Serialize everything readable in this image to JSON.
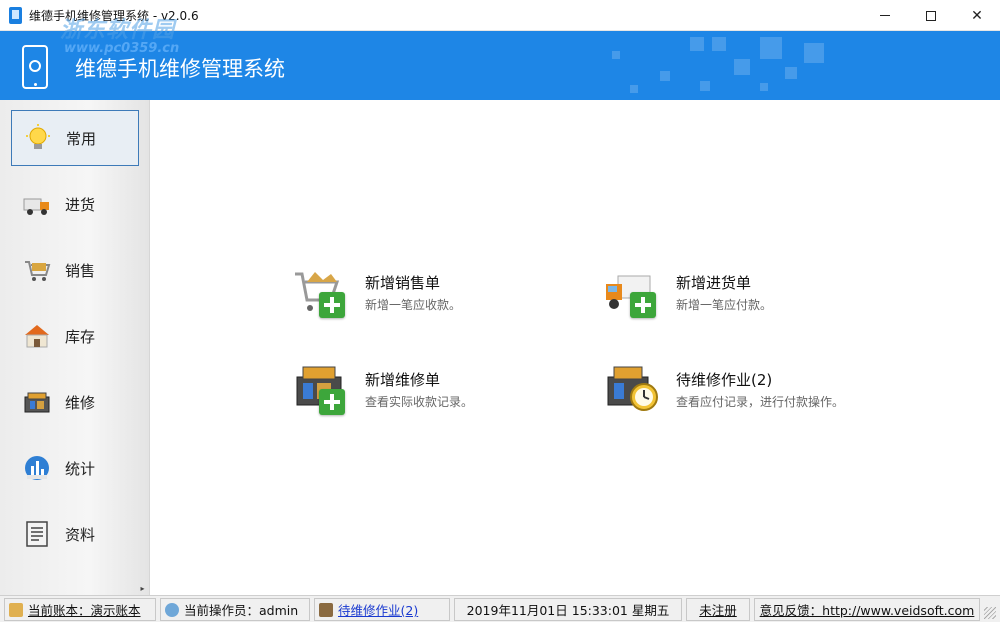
{
  "window": {
    "title": "维德手机维修管理系统 - v2.0.6"
  },
  "watermark": {
    "text": "浙东软件园",
    "url": "www.pc0359.cn"
  },
  "header": {
    "title": "维德手机维修管理系统"
  },
  "sidebar": {
    "items": [
      {
        "label": "常用",
        "icon": "bulb-icon",
        "active": true
      },
      {
        "label": "进货",
        "icon": "truck-icon"
      },
      {
        "label": "销售",
        "icon": "cart-icon"
      },
      {
        "label": "库存",
        "icon": "warehouse-icon"
      },
      {
        "label": "维修",
        "icon": "toolbox-icon"
      },
      {
        "label": "统计",
        "icon": "chart-icon"
      },
      {
        "label": "资料",
        "icon": "document-icon"
      }
    ]
  },
  "actions": [
    {
      "title": "新增销售单",
      "desc": "新增一笔应收款。",
      "icon": "cart-add-icon"
    },
    {
      "title": "新增进货单",
      "desc": "新增一笔应付款。",
      "icon": "truck-add-icon"
    },
    {
      "title": "新增维修单",
      "desc": "查看实际收款记录。",
      "icon": "toolbox-add-icon"
    },
    {
      "title": "待维修作业(2)",
      "desc": "查看应付记录，进行付款操作。",
      "icon": "toolbox-clock-icon"
    }
  ],
  "status": {
    "account": "当前账本：演示账本",
    "operator": "当前操作员：admin",
    "pending": "待维修作业(2)",
    "datetime": "2019年11月01日 15:33:01 星期五",
    "register": "未注册",
    "feedback": "意见反馈：http://www.veidsoft.com"
  }
}
